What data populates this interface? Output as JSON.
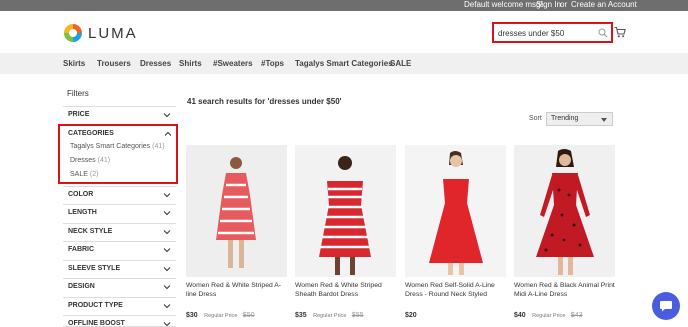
{
  "topbar": {
    "welcome": "Default welcome msg!",
    "signin": "Sign In",
    "or": "or",
    "create": "Create an Account"
  },
  "logo": {
    "text": "LUMA"
  },
  "search": {
    "value": "dresses under $50"
  },
  "nav": [
    "Skirts",
    "Trousers",
    "Dresses",
    "Shirts",
    "#Sweaters",
    "#Tops",
    "Tagalys Smart Categories",
    "SALE"
  ],
  "filters": {
    "title": "Filters",
    "price": "PRICE",
    "categories": {
      "title": "CATEGORIES",
      "options": [
        {
          "label": "Tagalys Smart Categories",
          "count": "(41)"
        },
        {
          "label": "Dresses",
          "count": "(41)"
        },
        {
          "label": "SALE",
          "count": "(2)"
        }
      ]
    },
    "rest": [
      "COLOR",
      "LENGTH",
      "NECK STYLE",
      "FABRIC",
      "SLEEVE STYLE",
      "DESIGN",
      "PRODUCT TYPE",
      "OFFLINE BOOST"
    ]
  },
  "results": {
    "title": "41 search results for 'dresses under $50'"
  },
  "sort": {
    "label": "Sort",
    "value": "Trending"
  },
  "products": [
    {
      "name": "Women Red & White Striped A-line Dress",
      "price": "$30",
      "regular_label": "Regular Price",
      "regular": "$50",
      "img_color": "#e75b5e"
    },
    {
      "name": "Women Red & White Striped Sheath Bardot Dress",
      "price": "$35",
      "regular_label": "Regular Price",
      "regular": "$55",
      "img_color": "#d8272f"
    },
    {
      "name": "Women Red Self-Solid A-Line Dress - Round Neck Styled",
      "price": "$20",
      "regular_label": "",
      "regular": "",
      "img_color": "#e0262b"
    },
    {
      "name": "Women Red & Black Animal Print Midi A-Line Dress",
      "price": "$40",
      "regular_label": "Regular Price",
      "regular": "$43",
      "img_color": "#c21a24"
    }
  ],
  "colors": {
    "highlight": "#d7141a",
    "chat": "#4a5de0"
  }
}
